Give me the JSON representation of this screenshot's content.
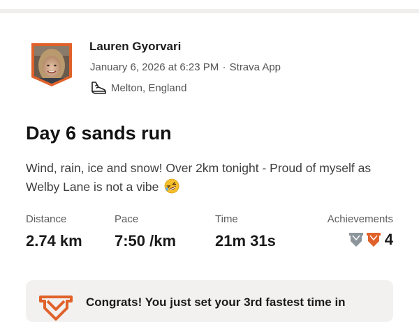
{
  "activity": {
    "athlete_name": "Lauren Gyorvari",
    "date": "January 6, 2026 at 6:23 PM",
    "separator": "·",
    "source": "Strava App",
    "activity_icon": "running-shoe-icon",
    "location": "Melton, England",
    "title": "Day 6 sands run",
    "description": "Wind, rain, ice and snow! Over 2km tonight - Proud of myself as Welby Lane is not a vibe",
    "description_emoji": "rolling-on-floor-laughing-emoji"
  },
  "stats": {
    "distance": {
      "label": "Distance",
      "value": "2.74 km"
    },
    "pace": {
      "label": "Pace",
      "value": "7:50 /km"
    },
    "time": {
      "label": "Time",
      "value": "21m 31s"
    },
    "achievements": {
      "label": "Achievements",
      "count": "4",
      "icons": [
        "silver-trophy-icon",
        "orange-trophy-icon"
      ]
    }
  },
  "achievement_card": {
    "icon": "trophy-icon",
    "text": "Congrats! You just set your 3rd fastest time in"
  },
  "colors": {
    "brand_orange": "#e0622a",
    "silver": "#8c959b",
    "card_background": "#f2f1ef"
  }
}
